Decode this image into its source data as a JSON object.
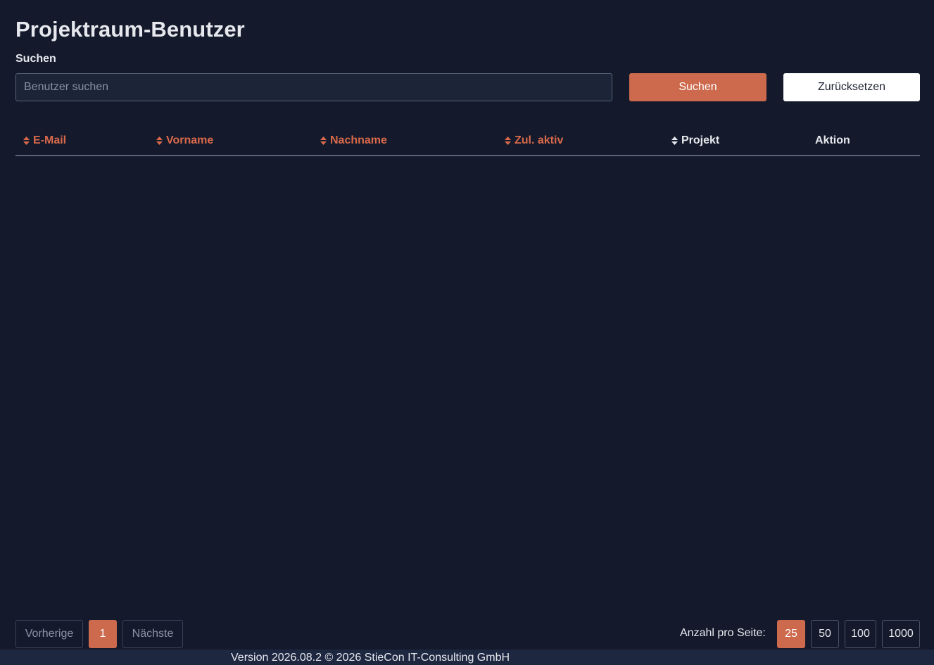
{
  "page": {
    "title": "Projektraum-Benutzer"
  },
  "search": {
    "label": "Suchen",
    "placeholder": "Benutzer suchen",
    "value": "",
    "submit_label": "Suchen",
    "reset_label": "Zurücksetzen"
  },
  "table": {
    "columns": [
      {
        "label": "E-Mail",
        "sortable": true,
        "icon": "sort-icon"
      },
      {
        "label": "Vorname",
        "sortable": true,
        "icon": "sort-icon"
      },
      {
        "label": "Nachname",
        "sortable": true,
        "icon": "sort-icon"
      },
      {
        "label": "Zul. aktiv",
        "sortable": true,
        "icon": "sort-icon"
      },
      {
        "label": "Projekt",
        "sortable": true,
        "icon": "sort-icon"
      },
      {
        "label": "Aktion",
        "sortable": false
      }
    ],
    "rows": []
  },
  "pagination": {
    "prev_label": "Vorherige",
    "current_page": "1",
    "next_label": "Nächste"
  },
  "per_page": {
    "label": "Anzahl pro Seite:",
    "options": [
      "25",
      "50",
      "100",
      "1000"
    ],
    "selected": "25"
  },
  "footer": {
    "text": "Version 2026.08.2 © 2026 StieCon IT-Consulting GmbH"
  },
  "colors": {
    "background": "#141a2b",
    "accent": "#cd6a4d",
    "footer_bg": "#1e2740"
  }
}
